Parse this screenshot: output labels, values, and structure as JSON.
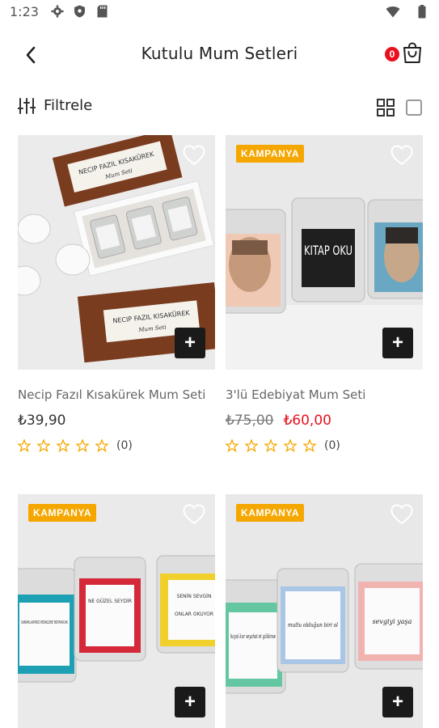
{
  "status_bar": {
    "time": "1:23"
  },
  "header": {
    "title": "Kutulu Mum Setleri",
    "cart_count": "0"
  },
  "toolbar": {
    "filter_label": "Filtrele"
  },
  "colors": {
    "accent_red": "#e8101e",
    "badge_orange": "#f5a700",
    "add_button": "#1a1a1a"
  },
  "products": [
    {
      "name": "Necip Fazıl Kısakürek Mum Seti",
      "price": "₺39,90",
      "badge": "",
      "review_count": "(0)"
    },
    {
      "name": "3'lü Edebiyat Mum Seti",
      "old_price": "₺75,00",
      "new_price": "₺60,00",
      "badge": "KAMPANYA",
      "review_count": "(0)"
    },
    {
      "badge": "KAMPANYA"
    },
    {
      "badge": "KAMPANYA"
    }
  ],
  "product_images": [
    {
      "box_text": "NECIP FAZIL KISAKÜREK",
      "box_subtext": "Mum Seti"
    },
    {
      "label": "KITAP OKU"
    },
    {
      "labels": [
        "SABAHLARIMIZI RENKLERE BOYAYACAK",
        "NE GÜZEL SEYDİR",
        "SENİN SEVGİN",
        "ONLAR OKUYOR"
      ]
    },
    {
      "labels": [
        "hayal kur seyahat et gülümse",
        "mutlu olduğun biri ol",
        "sevgiyi yaşa"
      ]
    }
  ]
}
